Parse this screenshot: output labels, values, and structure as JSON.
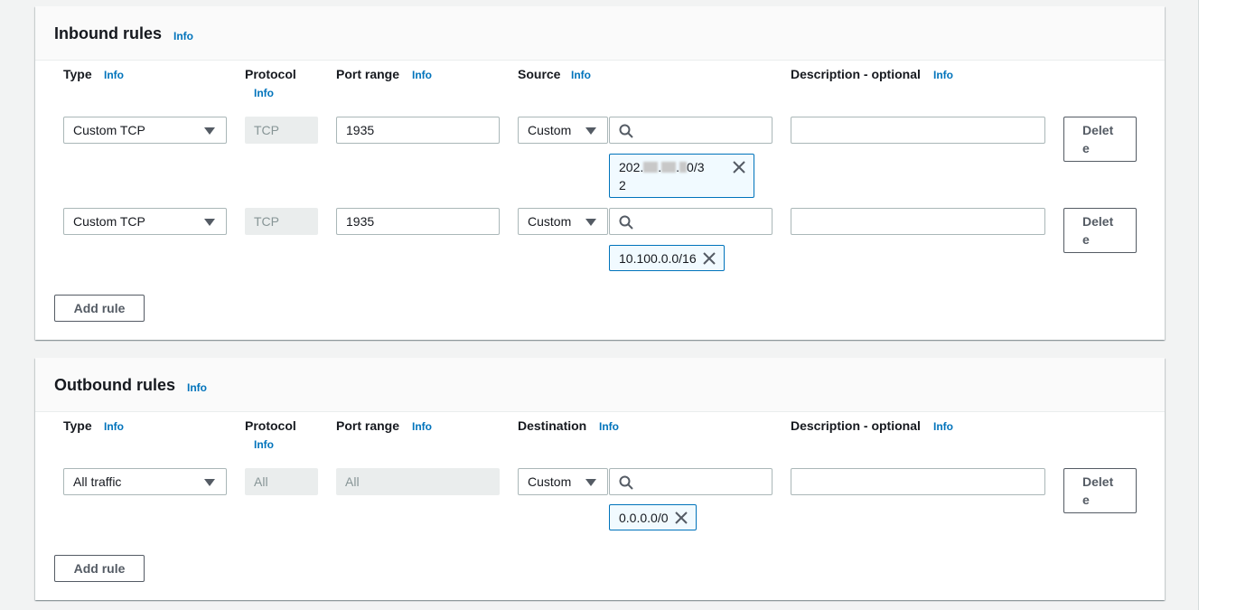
{
  "info_label": "Info",
  "columns": {
    "type": "Type",
    "protocol": "Protocol",
    "port_range": "Port range",
    "source": "Source",
    "destination": "Destination",
    "description": "Description - optional"
  },
  "inbound": {
    "title": "Inbound rules",
    "add_label": "Add rule",
    "rules": [
      {
        "type": "Custom TCP",
        "protocol": "TCP",
        "port_range": "1935",
        "source_type": "Custom",
        "search_value": "",
        "cidr_prefix": "202.",
        "cidr_sep1": ".",
        "cidr_sep2": ".",
        "cidr_suffix_a": "0/3",
        "cidr_suffix_b": "2",
        "description": "",
        "delete_a": "Delet",
        "delete_b": "e"
      },
      {
        "type": "Custom TCP",
        "protocol": "TCP",
        "port_range": "1935",
        "source_type": "Custom",
        "search_value": "",
        "cidr": "10.100.0.0/16",
        "description": "",
        "delete_a": "Delet",
        "delete_b": "e"
      }
    ]
  },
  "outbound": {
    "title": "Outbound rules",
    "add_label": "Add rule",
    "rules": [
      {
        "type": "All traffic",
        "protocol": "All",
        "port_range": "All",
        "destination_type": "Custom",
        "search_value": "",
        "cidr": "0.0.0.0/0",
        "description": "",
        "delete_a": "Delet",
        "delete_b": "e"
      }
    ]
  },
  "colors": {
    "link": "#0073bb",
    "token_border": "#0073bb",
    "token_bg": "#f1faff",
    "border": "#aab7b8",
    "disabled_bg": "#eaeded"
  }
}
